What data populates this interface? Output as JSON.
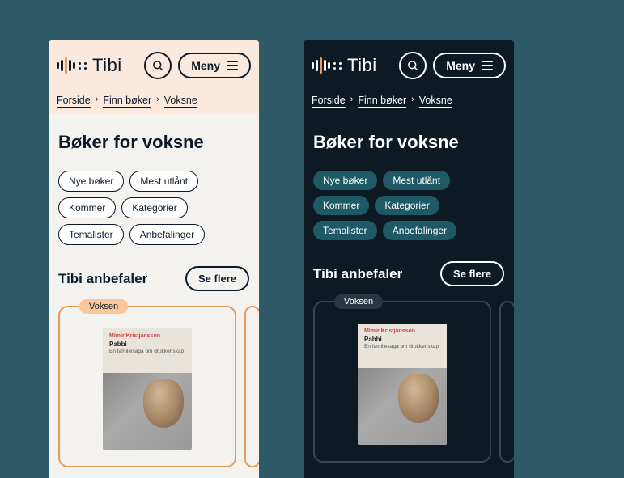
{
  "brand": "Tibi",
  "menu_label": "Meny",
  "breadcrumbs": [
    "Forside",
    "Finn bøker",
    "Voksne"
  ],
  "page_title": "Bøker for voksne",
  "filters": [
    "Nye bøker",
    "Mest utlånt",
    "Kommer",
    "Kategorier",
    "Temalister",
    "Anbefalinger"
  ],
  "section_title": "Tibi anbefaler",
  "see_all": "Se flere",
  "card_tag": "Voksen",
  "book": {
    "author": "Mímir Kristjánsson",
    "title": "Pabbi",
    "subtitle": "En familiesaga om drukkenskap"
  }
}
